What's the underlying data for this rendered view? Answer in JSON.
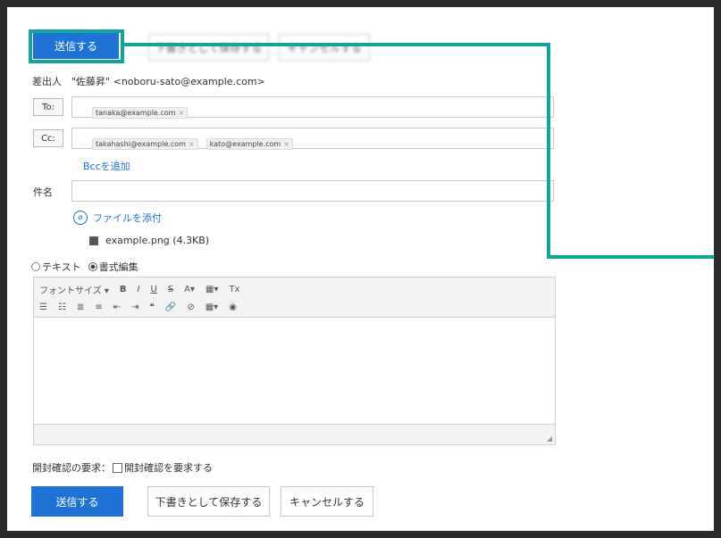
{
  "toolbar": {
    "send_label": "送信する",
    "draft_label": "下書きとして保存する",
    "cancel_label": "キャンセルする"
  },
  "sender": {
    "label": "差出人",
    "value": "\"佐藤昇\" <noboru-sato@example.com>"
  },
  "to": {
    "button": "To:",
    "chips": [
      "tanaka@example.com"
    ]
  },
  "cc": {
    "button": "Cc:",
    "chips": [
      "takahashi@example.com",
      "kato@example.com"
    ]
  },
  "bcc_link": "Bccを追加",
  "subject": {
    "label": "件名",
    "value": ""
  },
  "attach": {
    "link": "ファイルを添付",
    "file": "example.png (4.3KB)"
  },
  "format": {
    "text_option": "テキスト",
    "rich_option": "書式編集",
    "selected": "rich"
  },
  "editor": {
    "font_size_label": "フォントサイズ",
    "row1": [
      "B",
      "I",
      "U",
      "S",
      "A▾",
      "▦▾",
      "Tx"
    ],
    "row2": [
      "☰",
      "☷",
      "≣",
      "≡",
      "⇤",
      "⇥",
      "❝",
      "🔗",
      "⊘",
      "▦▾",
      "◉"
    ]
  },
  "read_receipt": {
    "label": "開封確認の要求：",
    "checkbox_label": "開封確認を要求する"
  },
  "footer": {
    "send_label": "送信する",
    "draft_label": "下書きとして保存する",
    "cancel_label": "キャンセルする"
  },
  "colors": {
    "primary": "#1f73d6",
    "highlight": "#12a69a"
  }
}
